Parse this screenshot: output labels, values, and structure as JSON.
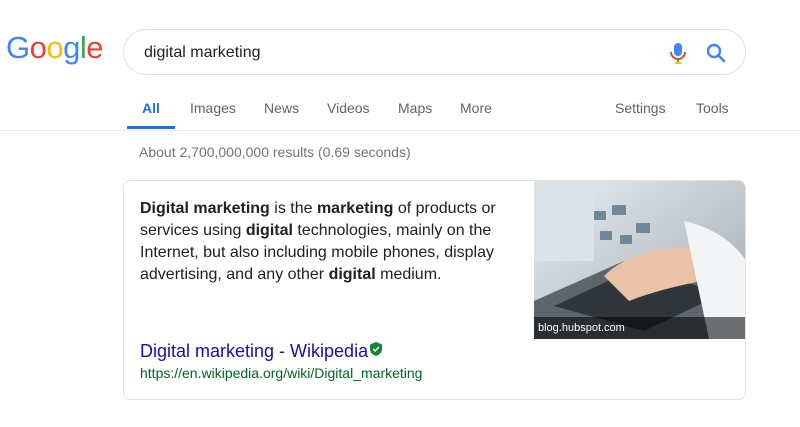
{
  "logo": {
    "letters": [
      {
        "char": "G",
        "color": "#4285F4"
      },
      {
        "char": "o",
        "color": "#EA4335"
      },
      {
        "char": "o",
        "color": "#FBBC05"
      },
      {
        "char": "g",
        "color": "#4285F4"
      },
      {
        "char": "l",
        "color": "#34A853"
      },
      {
        "char": "e",
        "color": "#EA4335"
      }
    ]
  },
  "search": {
    "query": "digital marketing",
    "mic_icon": "microphone-icon",
    "search_icon": "magnifier-icon"
  },
  "tabs": {
    "all": "All",
    "images": "Images",
    "news": "News",
    "videos": "Videos",
    "maps": "Maps",
    "more": "More",
    "settings": "Settings",
    "tools": "Tools",
    "active": "All",
    "active_color": "#1a73e8"
  },
  "results": {
    "stats": "About 2,700,000,000 results (0.69 seconds)"
  },
  "snippet": {
    "parts": [
      {
        "text": "Digital marketing",
        "bold": true
      },
      {
        "text": " is the ",
        "bold": false
      },
      {
        "text": "marketing",
        "bold": true
      },
      {
        "text": " of products or services using ",
        "bold": false
      },
      {
        "text": "digital",
        "bold": true
      },
      {
        "text": " technologies, mainly on the Internet, but also including mobile phones, display advertising, and any other ",
        "bold": false
      },
      {
        "text": "digital",
        "bold": true
      },
      {
        "text": " medium.",
        "bold": false
      }
    ],
    "image_caption": "blog.hubspot.com",
    "title": "Digital marketing - Wikipedia",
    "url": "https://en.wikipedia.org/wiki/Digital_marketing",
    "link_color": "#1a0dab",
    "url_color": "#006621"
  }
}
